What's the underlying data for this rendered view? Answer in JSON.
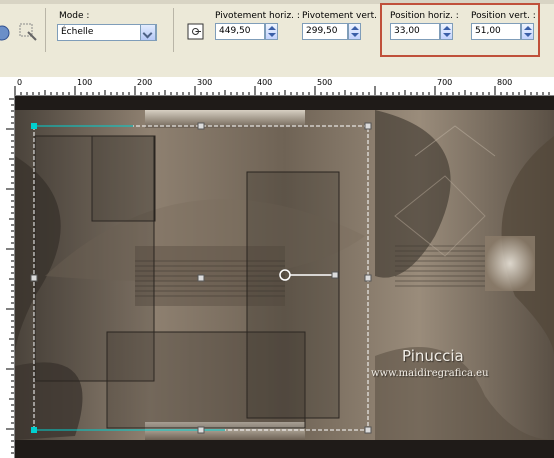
{
  "toolbar": {
    "mode": {
      "label": "Mode :",
      "value": "Échelle"
    },
    "pivot_h": {
      "label": "Pivotement horiz. :",
      "value": "449,50"
    },
    "pivot_v": {
      "label": "Pivotement vert. :",
      "value": "299,50"
    },
    "pos_h": {
      "label": "Position horiz. :",
      "value": "33,00"
    },
    "pos_v": {
      "label": "Position vert. :",
      "value": "51,00"
    }
  },
  "ruler": {
    "ticks": [
      "0",
      "100",
      "200",
      "300",
      "400",
      "500",
      "600",
      "700",
      "800"
    ]
  },
  "watermark": {
    "name": "Pinuccia",
    "url": "www.maidiregrafica.eu"
  },
  "colors": {
    "highlight": "#c0503a",
    "handle_accent": "#00d0d0"
  }
}
